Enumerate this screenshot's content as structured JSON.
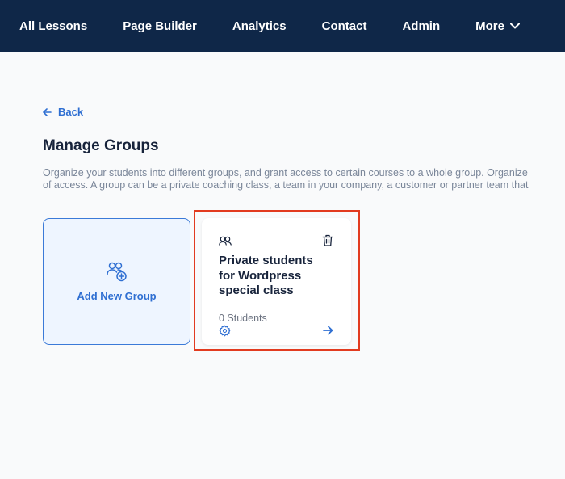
{
  "nav": {
    "items": [
      "All Lessons",
      "Page Builder",
      "Analytics",
      "Contact",
      "Admin"
    ],
    "more_label": "More"
  },
  "back_label": "Back",
  "page_title": "Manage Groups",
  "description": {
    "line1": "Organize your students into different groups, and grant access to certain courses to a whole group. Organize",
    "line2": "of access. A group can be a private coaching class, a team in your company, a customer or partner team that"
  },
  "add_group_label": "Add New Group",
  "groups": [
    {
      "name": "Private students for Wordpress special class",
      "count": "0 Students"
    }
  ],
  "colors": {
    "nav_bg": "#0f2748",
    "accent": "#2f6fd2",
    "highlight": "#e23b1f"
  }
}
